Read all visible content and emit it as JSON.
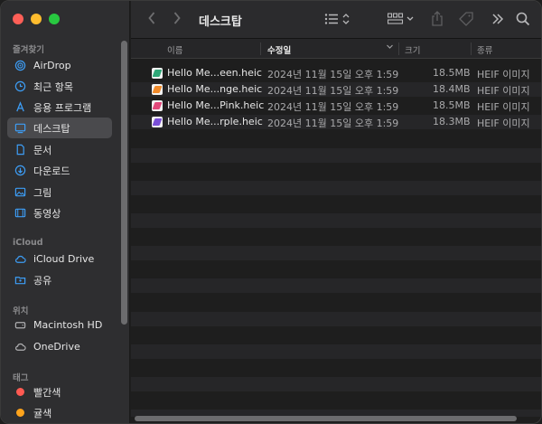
{
  "sidebar": {
    "sections": [
      {
        "label": "즐겨찾기"
      },
      {
        "label": "iCloud"
      },
      {
        "label": "위치"
      },
      {
        "label": "태그"
      }
    ],
    "items": [
      {
        "label": "AirDrop",
        "icon": "airdrop-icon"
      },
      {
        "label": "최근 항목",
        "icon": "clock-icon"
      },
      {
        "label": "응용 프로그램",
        "icon": "applications-icon"
      },
      {
        "label": "데스크탑",
        "icon": "desktop-icon",
        "active": true
      },
      {
        "label": "문서",
        "icon": "document-icon"
      },
      {
        "label": "다운로드",
        "icon": "download-icon"
      },
      {
        "label": "그림",
        "icon": "pictures-icon"
      },
      {
        "label": "동영상",
        "icon": "movies-icon"
      },
      {
        "label": "iCloud Drive",
        "icon": "icloud-icon"
      },
      {
        "label": "공유",
        "icon": "shared-folder-icon"
      },
      {
        "label": "Macintosh HD",
        "icon": "harddisk-icon"
      },
      {
        "label": "OneDrive",
        "icon": "cloud-icon"
      },
      {
        "label": "빨간색",
        "icon": "red-tag-icon",
        "color": "#ff5a52"
      },
      {
        "label": "귤색",
        "icon": "orange-tag-icon",
        "color": "#ffa41c"
      }
    ]
  },
  "toolbar": {
    "title": "데스크탑"
  },
  "columns": {
    "name": "이름",
    "modified": "수정일",
    "size": "크기",
    "kind": "종류"
  },
  "files": [
    {
      "name": "Hello Me...een.heic",
      "date": "2024년 11월 15일 오후 1:59",
      "size": "18.5MB",
      "kind": "HEIF 이미지",
      "thumb_color": "#2fa878"
    },
    {
      "name": "Hello Me...nge.heic",
      "date": "2024년 11월 15일 오후 1:59",
      "size": "18.4MB",
      "kind": "HEIF 이미지",
      "thumb_color": "#f08a2a"
    },
    {
      "name": "Hello Me...Pink.heic",
      "date": "2024년 11월 15일 오후 1:59",
      "size": "18.5MB",
      "kind": "HEIF 이미지",
      "thumb_color": "#e2487a"
    },
    {
      "name": "Hello Me...rple.heic",
      "date": "2024년 11월 15일 오후 1:59",
      "size": "18.3MB",
      "kind": "HEIF 이미지",
      "thumb_color": "#7a4fd8"
    }
  ]
}
